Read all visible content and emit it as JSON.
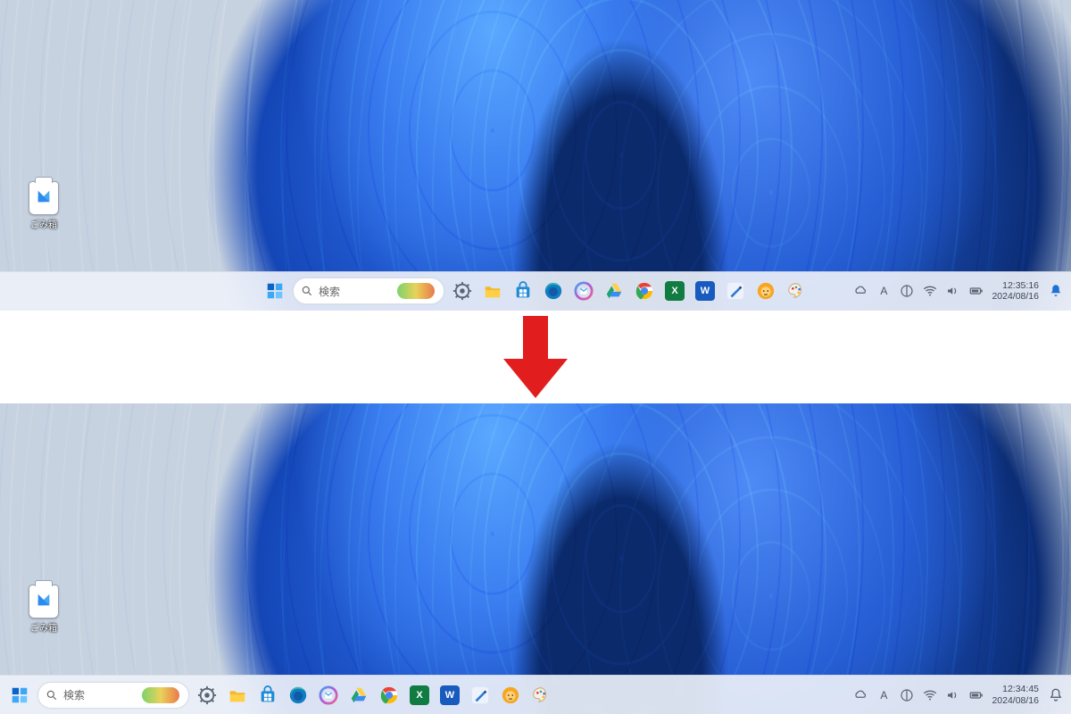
{
  "desktop": {
    "recycle_bin_label": "ごみ箱"
  },
  "search": {
    "placeholder": "検索"
  },
  "taskbar_icons": [
    {
      "name": "start",
      "kind": "start"
    },
    {
      "name": "settings",
      "kind": "gear"
    },
    {
      "name": "file-explorer",
      "kind": "folder"
    },
    {
      "name": "microsoft-store",
      "kind": "store"
    },
    {
      "name": "edge",
      "kind": "edge"
    },
    {
      "name": "outlook-new",
      "kind": "outlooknew"
    },
    {
      "name": "google-drive",
      "kind": "gdrive"
    },
    {
      "name": "chrome",
      "kind": "chrome"
    },
    {
      "name": "excel",
      "kind": "letter",
      "bg": "#107c41",
      "ch": "X"
    },
    {
      "name": "word",
      "kind": "letter",
      "bg": "#185abd",
      "ch": "W"
    },
    {
      "name": "pen-app",
      "kind": "pen"
    },
    {
      "name": "lion-app",
      "kind": "lion"
    },
    {
      "name": "paint",
      "kind": "paint"
    }
  ],
  "tray": {
    "items": [
      "onedrive",
      "ime-a",
      "ime-toggle",
      "wifi",
      "volume",
      "battery"
    ],
    "ime_label": "A"
  },
  "top": {
    "time": "12:35:16",
    "date": "2024/08/16",
    "notification": "filled",
    "alignment": "center"
  },
  "bottom": {
    "time": "12:34:45",
    "date": "2024/08/16",
    "notification": "outline",
    "alignment": "left"
  }
}
